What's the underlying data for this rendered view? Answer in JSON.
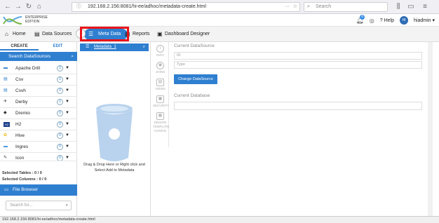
{
  "browser": {
    "url": "192.168.2.156:8081/hi-ee/adhoc/metadata-create.html",
    "search_placeholder": "Search",
    "menu_icon": "hamburger-icon"
  },
  "header": {
    "edition": "ENTERPRISE EDITION",
    "notifications_count": "0",
    "help_label": "Help",
    "user_initials": "HI",
    "user_name": "hiadmin"
  },
  "tabs": [
    {
      "label": "Home",
      "icon": "home-icon"
    },
    {
      "label": "Data Sources",
      "icon": "database-icon"
    },
    {
      "label": "Meta Data",
      "icon": "list-icon"
    },
    {
      "label": "Reports",
      "icon": "report-icon"
    },
    {
      "label": "Dashboard Designer",
      "icon": "dashboard-icon"
    }
  ],
  "left_panel": {
    "tabs": [
      "CREATE",
      "EDIT"
    ],
    "search_label": "Search DataSources",
    "datasources": [
      {
        "name": "Apache Drill",
        "count": "2"
      },
      {
        "name": "Csv",
        "count": "2"
      },
      {
        "name": "Csvh",
        "count": "0"
      },
      {
        "name": "Derby",
        "count": "1"
      },
      {
        "name": "Dremio",
        "count": "0"
      },
      {
        "name": "H2",
        "count": "0"
      },
      {
        "name": "Hive",
        "count": "0"
      },
      {
        "name": "Ingres",
        "count": "0"
      },
      {
        "name": "Icon",
        "count": "0"
      }
    ],
    "selected_tables": "Selected Tables : 0 / 0",
    "selected_columns": "Selected Columns : 0 / 0",
    "file_browser": "File Browser",
    "search_for_placeholder": "Search for..."
  },
  "middle_panel": {
    "metadata_name": "Metadata_1",
    "drop_text_line1": "Drag & Drop Here or Right click and",
    "drop_text_line2": "Select Add to Metadata"
  },
  "side_icons": [
    "INFO",
    "JOINS",
    "VIEWS",
    "SECURITY",
    "DESIGN TEMPLATE CONFIG"
  ],
  "right_panel": {
    "current_datasource": "Current DataSource",
    "id_placeholder": "ID",
    "type_placeholder": "Type",
    "change_button": "Change DataSource",
    "current_database": "Current Database"
  },
  "status_bar": "192.168.2.156:8081/hi-ee/adhoc/metadata-create.html"
}
